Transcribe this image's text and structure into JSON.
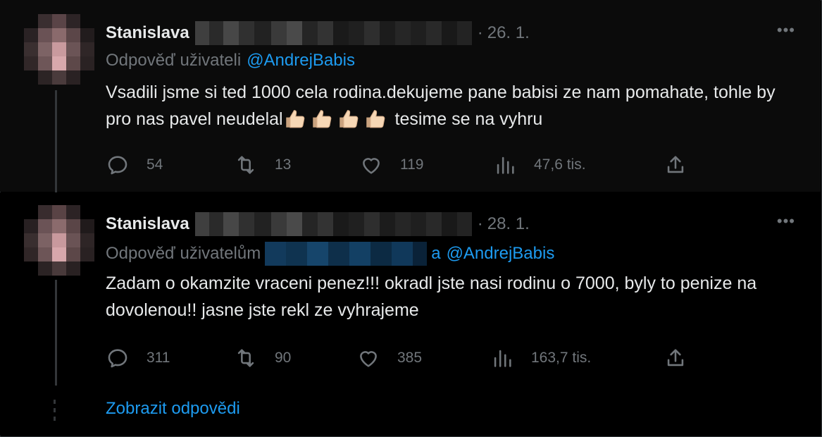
{
  "tweets": [
    {
      "author_name": "Stanislava",
      "date_sep": "·",
      "date": "26. 1.",
      "menu": "•••",
      "reply_prefix": "Odpověď uživateli",
      "mention": "@AndrejBabis",
      "text_before_emoji": "Vsadili jsme si ted 1000 cela rodina.dekujeme pane babisi ze nam pomahate, tohle by pro nas pavel neudelal",
      "text_after_emoji": " tesime se na vyhru",
      "emoji_count": 4,
      "emoji_icon": "thumbs-up-icon",
      "replies": "54",
      "reposts": "13",
      "likes": "119",
      "views": "47,6 tis."
    },
    {
      "author_name": "Stanislava",
      "date_sep": "·",
      "date": "28. 1.",
      "menu": "•••",
      "reply_prefix": "Odpověď uživatelům",
      "mention_joiner": "a",
      "mention": "@AndrejBabis",
      "text": "Zadam o okamzite vraceni penez!!! okradl jste nasi rodinu o 7000, byly to penize na dovolenou!! jasne jste rekl ze vyhrajeme",
      "replies": "311",
      "reposts": "90",
      "likes": "385",
      "views": "163,7 tis."
    }
  ],
  "show_replies": "Zobrazit odpovědi",
  "icons": {
    "reply": "reply-icon",
    "repost": "repost-icon",
    "like": "heart-icon",
    "views": "views-chart-icon",
    "share": "share-icon"
  },
  "colors": {
    "background": "#000000",
    "text": "#e7e9ea",
    "muted": "#71767b",
    "accent": "#1d9bf0"
  }
}
